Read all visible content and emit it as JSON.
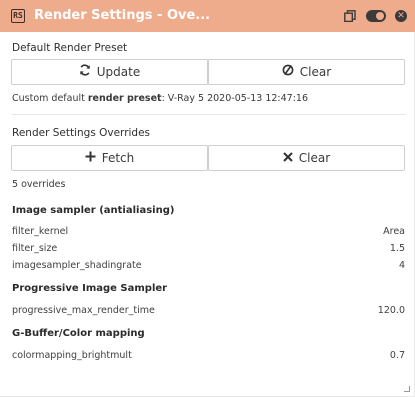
{
  "window": {
    "title": "Render Settings - Ove...",
    "app_icon": "RS",
    "accent": "#efac8c",
    "titlebar_icons": [
      "copy-icon",
      "toggle-switch-icon",
      "close-icon"
    ]
  },
  "preset_section": {
    "heading": "Default Render Preset",
    "update_label": "Update",
    "update_icon": "refresh-icon",
    "clear_label": "Clear",
    "clear_icon": "no-entry-icon",
    "info_prefix": "Custom default ",
    "info_bold": "render preset",
    "info_suffix": ": V-Ray 5 2020-05-13 12:47:16"
  },
  "overrides_section": {
    "heading": "Render Settings Overrides",
    "fetch_label": "Fetch",
    "fetch_icon": "plus-icon",
    "clear_label": "Clear",
    "clear_icon": "x-icon",
    "count_text": "5 overrides"
  },
  "groups": [
    {
      "title": "Image sampler (antialiasing)",
      "rows": [
        {
          "key": "filter_kernel",
          "value": "Area"
        },
        {
          "key": "filter_size",
          "value": "1.5"
        },
        {
          "key": "imagesampler_shadingrate",
          "value": "4"
        }
      ]
    },
    {
      "title": "Progressive Image Sampler",
      "rows": [
        {
          "key": "progressive_max_render_time",
          "value": "120.0"
        }
      ]
    },
    {
      "title": "G-Buffer/Color mapping",
      "rows": [
        {
          "key": "colormapping_brightmult",
          "value": "0.7"
        }
      ]
    }
  ]
}
